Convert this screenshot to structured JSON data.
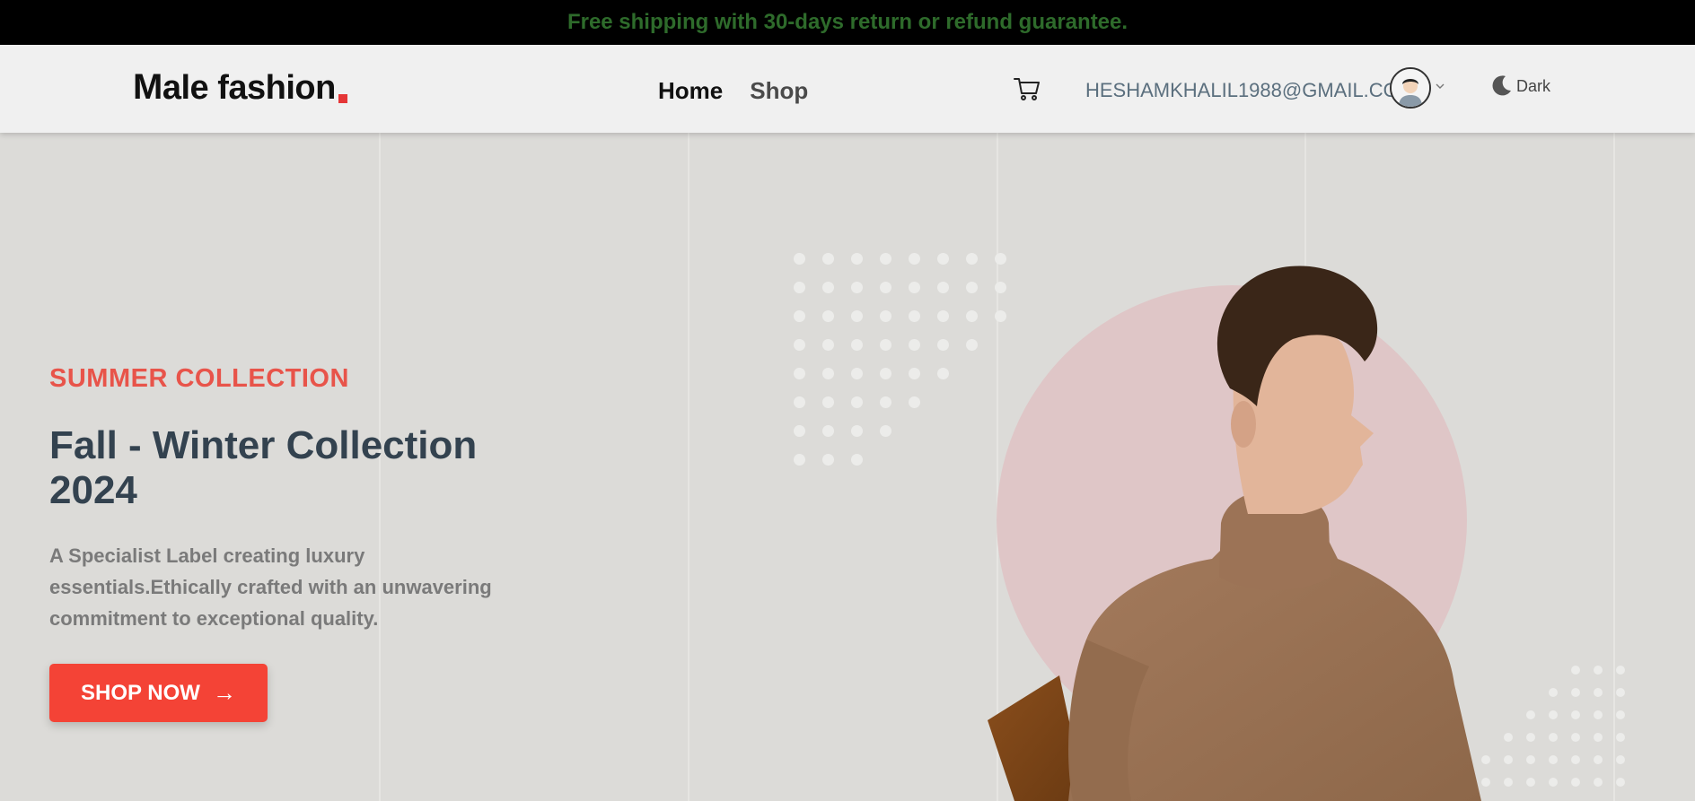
{
  "announcement": "Free shipping with 30-days return or refund guarantee.",
  "header": {
    "logo": {
      "first": "M",
      "rest": "ale fashion"
    },
    "nav": {
      "home": "Home",
      "shop": "Shop"
    },
    "user_email": "HESHAMKHALIL1988@GMAIL.COM",
    "theme_toggle": "Dark"
  },
  "hero": {
    "subtitle": "SUMMER COLLECTION",
    "title": "Fall - Winter Collection 2024",
    "description": "A Specialist Label creating luxury essentials.Ethically crafted with an unwavering commitment to exceptional quality.",
    "cta": "SHOP NOW",
    "cta_icon": "→"
  },
  "colors": {
    "accent": "#e8544a",
    "button": "#f44336",
    "announcement_text": "#2e6b2b",
    "email_text": "#5b6f7e"
  },
  "icons": [
    "cart-icon",
    "avatar",
    "chevron-down-icon",
    "moon-icon",
    "arrow-right-icon"
  ]
}
